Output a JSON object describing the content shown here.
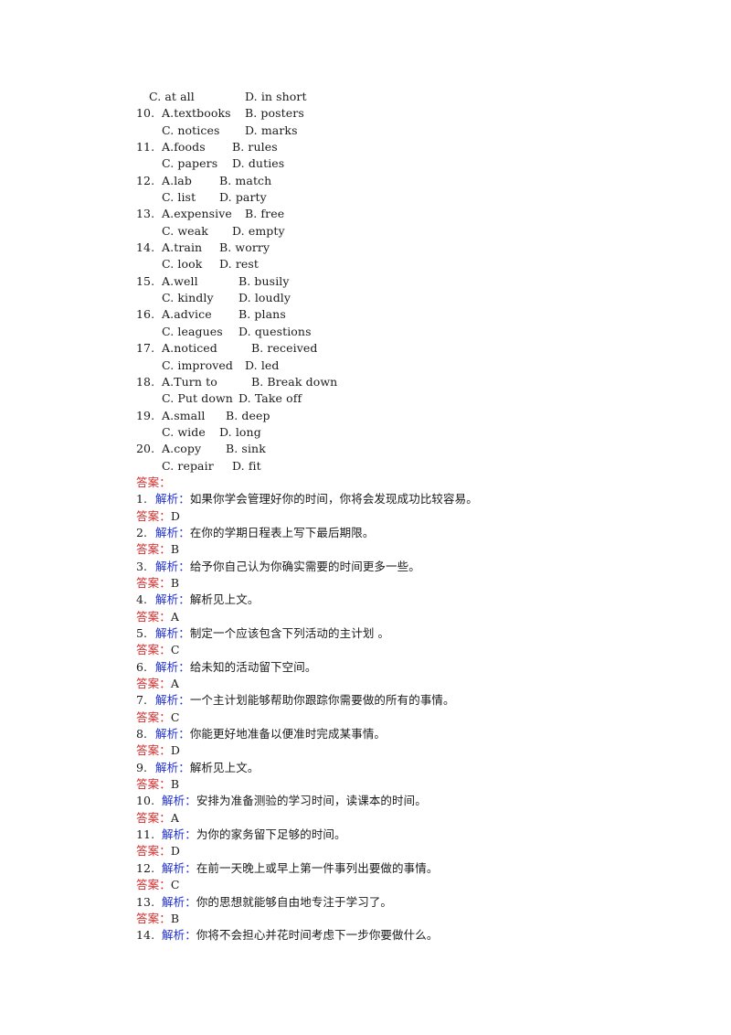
{
  "questions_tail": {
    "first_line": {
      "c": "C. at all",
      "d": "D. in short"
    },
    "items": [
      {
        "num": "10.",
        "a": "A.textbooks",
        "b": "B. posters",
        "c": "C. notices",
        "d": "D. marks"
      },
      {
        "num": "11.",
        "a": "A.foods",
        "b": "B. rules",
        "c": "C. papers",
        "d": "D. duties"
      },
      {
        "num": "12.",
        "a": "A.lab",
        "b": "B. match",
        "c": "C. list",
        "d": "D. party"
      },
      {
        "num": "13.",
        "a": "A.expensive",
        "b": "B. free",
        "c": "C. weak",
        "d": "D. empty"
      },
      {
        "num": "14.",
        "a": "A.train",
        "b": "B. worry",
        "c": "C. look",
        "d": "D. rest"
      },
      {
        "num": "15.",
        "a": "A.well",
        "b": "B. busily",
        "c": "C. kindly",
        "d": "D. loudly"
      },
      {
        "num": "16.",
        "a": "A.advice",
        "b": "B. plans",
        "c": "C. leagues",
        "d": "D. questions"
      },
      {
        "num": "17.",
        "a": "A.noticed",
        "b": "B. received",
        "c": "C. improved",
        "d": "D. led"
      },
      {
        "num": "18.",
        "a": "A.Turn to",
        "b": "B. Break down",
        "c": "C. Put down",
        "d": "D. Take off"
      },
      {
        "num": "19.",
        "a": "A.small",
        "b": "B. deep",
        "c": "C. wide",
        "d": "D. long"
      },
      {
        "num": "20.",
        "a": "A.copy",
        "b": "B. sink",
        "c": "C. repair",
        "d": "D. fit"
      }
    ]
  },
  "answers": {
    "header": "答案：",
    "answer_label": "答案：",
    "explanation_label": "解析：",
    "colors": {
      "answer_label": "#d42a2a",
      "explanation_label": "#1f2fd0"
    },
    "entries": [
      {
        "num": "1.",
        "explanation": "如果你学会管理好你的时间，你将会发现成功比较容易。",
        "answer": "D"
      },
      {
        "num": "2.",
        "explanation": "在你的学期日程表上写下最后期限。",
        "answer": "B"
      },
      {
        "num": "3.",
        "explanation": "给予你自己认为你确实需要的时间更多一些。",
        "answer": "B"
      },
      {
        "num": "4.",
        "explanation": "解析见上文。",
        "answer": "A"
      },
      {
        "num": "5.",
        "explanation": "制定一个应该包含下列活动的主计划 。",
        "answer": "C"
      },
      {
        "num": "6.",
        "explanation": "给未知的活动留下空间。",
        "answer": "A"
      },
      {
        "num": "7.",
        "explanation": "一个主计划能够帮助你跟踪你需要做的所有的事情。",
        "answer": "C"
      },
      {
        "num": "8.",
        "explanation": "你能更好地准备以便准时完成某事情。",
        "answer": "D"
      },
      {
        "num": "9.",
        "explanation": "解析见上文。",
        "answer": "B"
      },
      {
        "num": "10.",
        "explanation": "安排为准备测验的学习时间，读课本的时间。",
        "answer": "A"
      },
      {
        "num": "11.",
        "explanation": "为你的家务留下足够的时间。",
        "answer": "D"
      },
      {
        "num": "12.",
        "explanation": "在前一天晚上或早上第一件事列出要做的事情。",
        "answer": "C"
      },
      {
        "num": "13.",
        "explanation": "你的思想就能够自由地专注于学习了。",
        "answer": "B"
      },
      {
        "num": "14.",
        "explanation": "你将不会担心并花时间考虑下一步你要做什么。",
        "answer": null
      }
    ]
  }
}
